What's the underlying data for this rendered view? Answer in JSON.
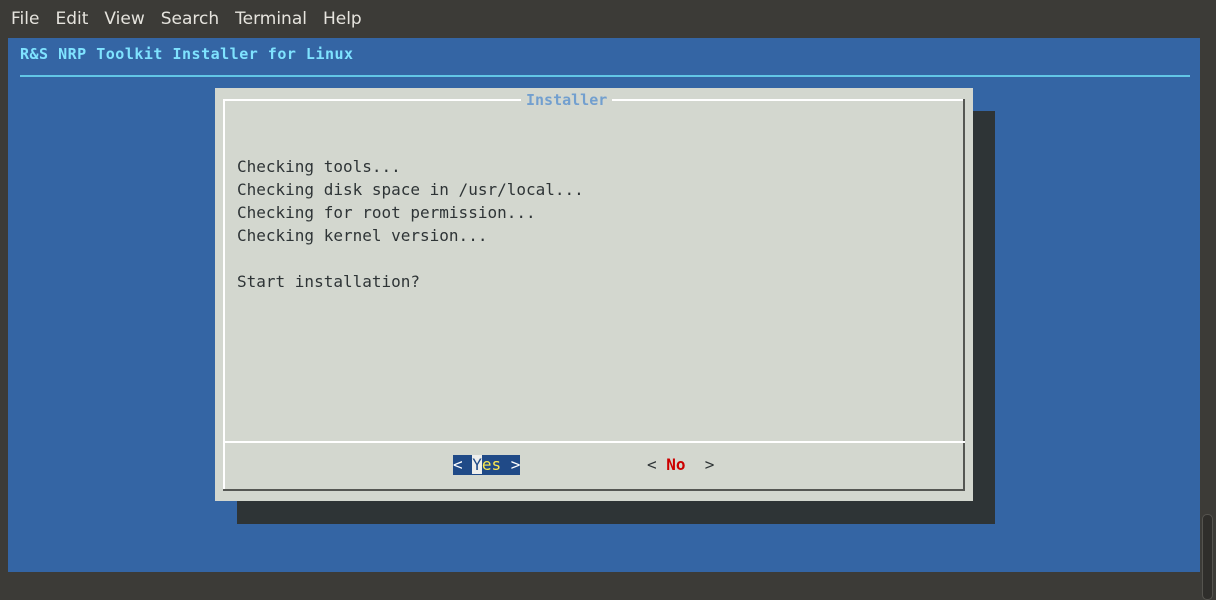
{
  "menubar": {
    "items": [
      "File",
      "Edit",
      "View",
      "Search",
      "Terminal",
      "Help"
    ]
  },
  "terminal": {
    "app_title": "R&S NRP Toolkit Installer for Linux"
  },
  "dialog": {
    "title": "Installer",
    "lines": [
      "Checking tools...",
      "Checking disk space in /usr/local...",
      "Checking for root permission...",
      "Checking kernel version..."
    ],
    "question": "Start installation?",
    "buttons": {
      "yes": {
        "open": "< ",
        "hotkey": "Y",
        "rest": "es",
        "close": " >"
      },
      "no": {
        "open": "< ",
        "hotkey": "No",
        "close": "  >"
      }
    }
  },
  "colors": {
    "terminal_bg": "#3465a4",
    "title_text": "#7fe3ff",
    "dialog_bg": "#d3d7cf",
    "dialog_title": "#729fcf",
    "selected_button_bg": "#204a87",
    "hotkey_no": "#cc0000"
  }
}
